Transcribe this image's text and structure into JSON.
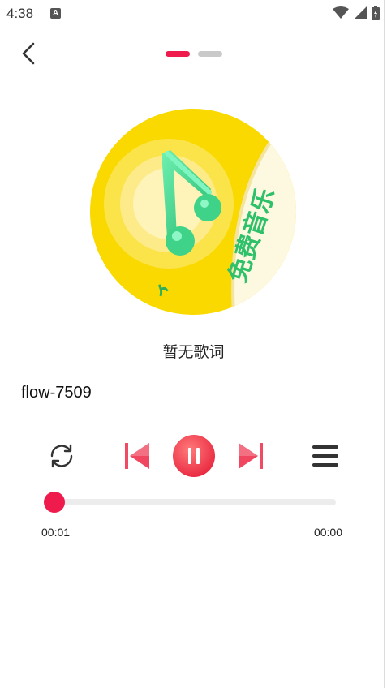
{
  "status_bar": {
    "time": "4:38",
    "notification_icon": "a-notification-icon",
    "icons": [
      "wifi-icon",
      "cellular-signal-icon",
      "battery-icon"
    ]
  },
  "header": {
    "back_icon": "chevron-left-icon",
    "page_count": 2,
    "active_page": 1
  },
  "album": {
    "badge_text": "免费音乐",
    "icon": "music-note-icon"
  },
  "lyrics": {
    "text": "暂无歌词"
  },
  "song": {
    "title": "flow-7509"
  },
  "controls": {
    "repeat_icon": "repeat-icon",
    "prev_icon": "skip-previous-icon",
    "play_pause_icon": "pause-icon",
    "next_icon": "skip-next-icon",
    "playlist_icon": "playlist-icon"
  },
  "progress": {
    "current_time": "00:01",
    "total_time": "00:00",
    "fraction": 0.0
  },
  "colors": {
    "accent": "#ef1b4d",
    "indicator_inactive": "#c9c9c9",
    "album_yellow": "#fad900",
    "note_green": "#3fd38a",
    "badge_green": "#2fc06a"
  }
}
